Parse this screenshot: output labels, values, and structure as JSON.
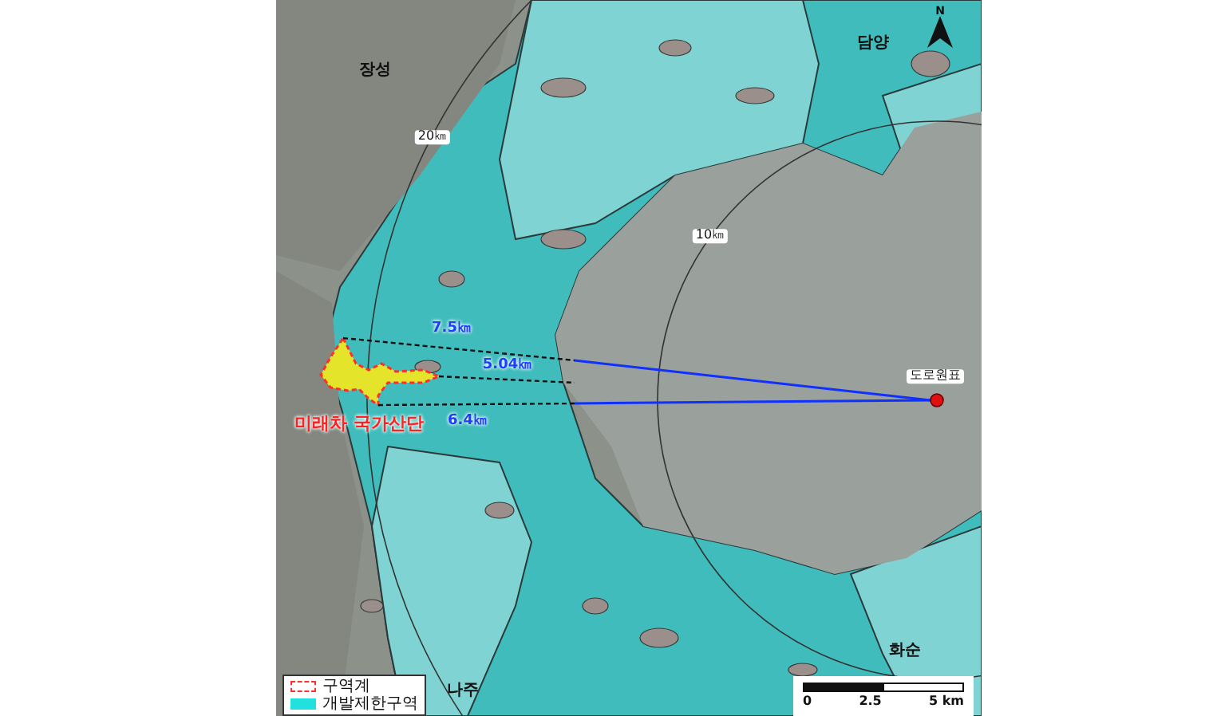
{
  "map": {
    "region_labels": [
      "장성",
      "담양",
      "나주",
      "화순"
    ],
    "ring_labels": [
      "20㎞",
      "10㎞"
    ],
    "distance_labels": [
      "7.5㎞",
      "5.04㎞",
      "6.4㎞"
    ],
    "site_label": "미래차 국가산단",
    "landmark_label": "도로원표",
    "north_label": "N",
    "scale": {
      "ticks": [
        "0",
        "2.5",
        "5 km"
      ]
    },
    "legend": [
      {
        "kind": "boundary",
        "label": "구역계"
      },
      {
        "kind": "restricted",
        "label": "개발제한구역"
      }
    ]
  }
}
